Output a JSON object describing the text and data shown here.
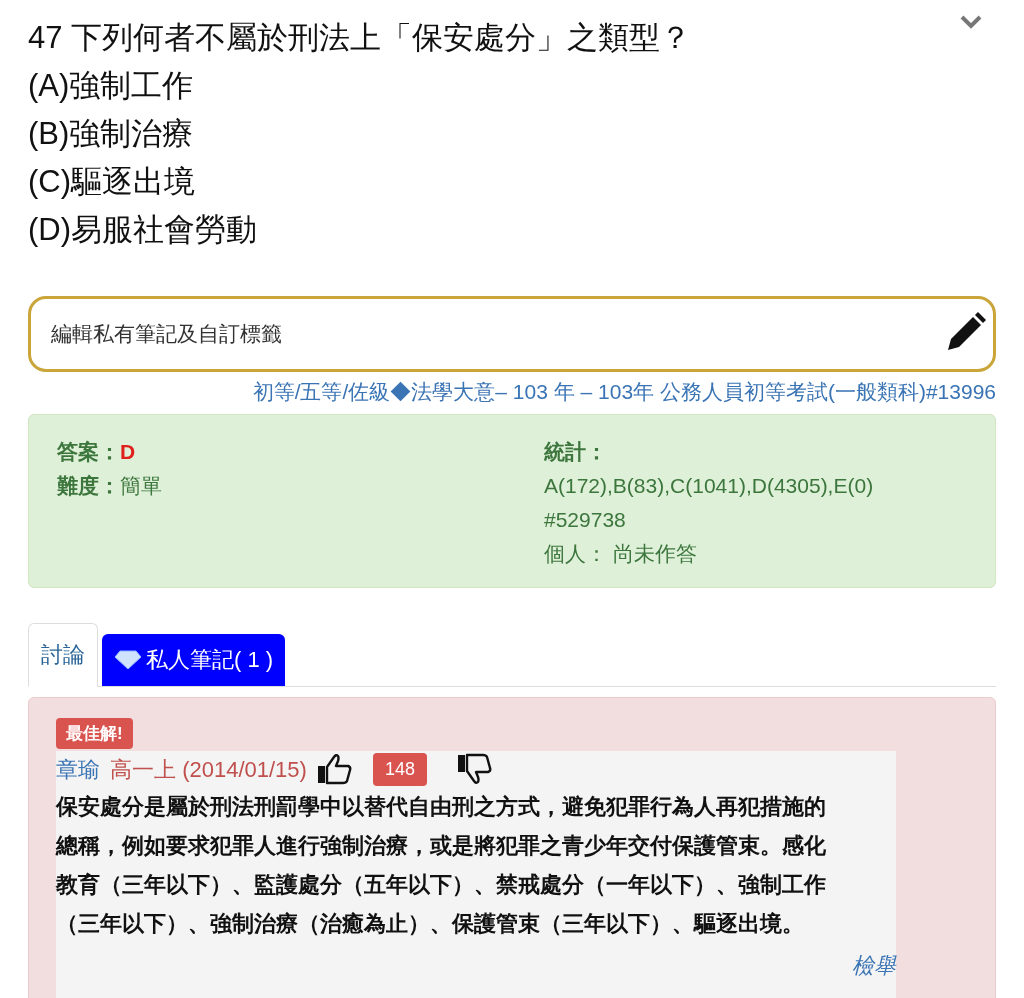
{
  "question": {
    "number": "47",
    "text": "下列何者不屬於刑法上「保安處分」之類型？",
    "options": [
      "(A)強制工作",
      "(B)強制治療",
      "(C)驅逐出境",
      "(D)易服社會勞動"
    ]
  },
  "note_field": {
    "placeholder": "編輯私有筆記及自訂標籤"
  },
  "source": "初等/五等/佐級◆法學大意– 103 年 – 103年 公務人員初等考試(一般類科)#13996",
  "info": {
    "answer_label": "答案：",
    "answer": "D",
    "difficulty_label": "難度：",
    "difficulty": "簡單",
    "stats_label": "統計：",
    "stats": "A(172),B(83),C(1041),D(4305),E(0)",
    "stats_id": "#529738",
    "personal_label": "個人：",
    "personal": "尚未作答"
  },
  "tabs": [
    {
      "label": "討論",
      "selected": true,
      "kind": "plain"
    },
    {
      "label": "私人筆記( 1 )",
      "selected": false,
      "kind": "premium"
    }
  ],
  "post": {
    "badge": "最佳解!",
    "author": "章瑜",
    "level": "高一上",
    "date": "(2014/01/15)",
    "votes": "148",
    "body": "保安處分是屬於刑法刑罰學中以替代自由刑之方式，避免犯罪行為人再犯措施的總稱，例如要求犯罪人進行強制治療，或是將犯罪之青少年交付保護管束。感化教育（三年以下）、監護處分（五年以下）、禁戒處分（一年以下）、強制工作（三年以下）、強制治療（治癒為止）、保護管束（三年以下）、驅逐出境。",
    "report": "檢舉"
  }
}
